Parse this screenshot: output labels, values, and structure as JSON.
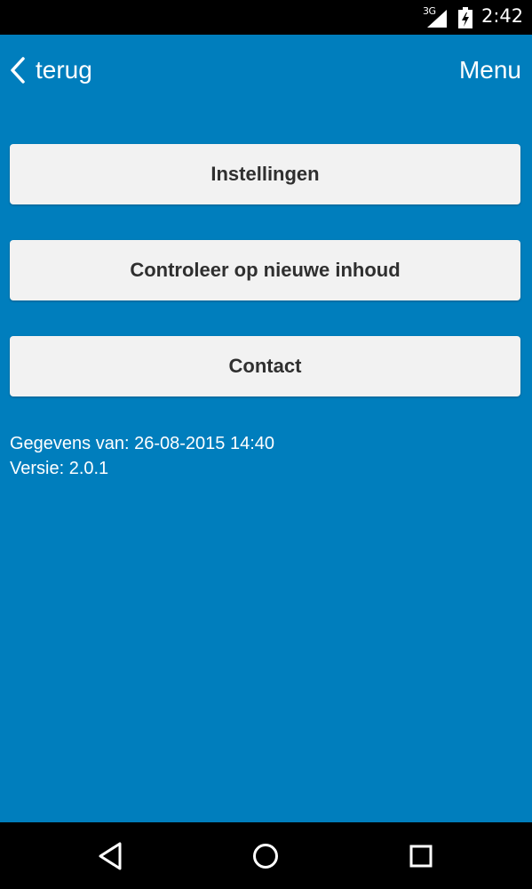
{
  "status_bar": {
    "network": "3G",
    "time": "2:42",
    "icons": [
      "signal-icon",
      "battery-icon"
    ]
  },
  "header": {
    "back_label": "terug",
    "back_icon": "chevron-left-icon",
    "menu_label": "Menu"
  },
  "buttons": [
    {
      "label": "Instellingen"
    },
    {
      "label": "Controleer op nieuwe inhoud"
    },
    {
      "label": "Contact"
    }
  ],
  "info": {
    "data_date": "Gegevens van: 26-08-2015 14:40",
    "version": "Versie: 2.0.1"
  },
  "nav_bar": {
    "icons": [
      "back-triangle-icon",
      "home-circle-icon",
      "recents-square-icon"
    ]
  },
  "colors": {
    "background": "#007ebd",
    "button": "#f2f2f2",
    "button_text": "#2f2f2f"
  }
}
